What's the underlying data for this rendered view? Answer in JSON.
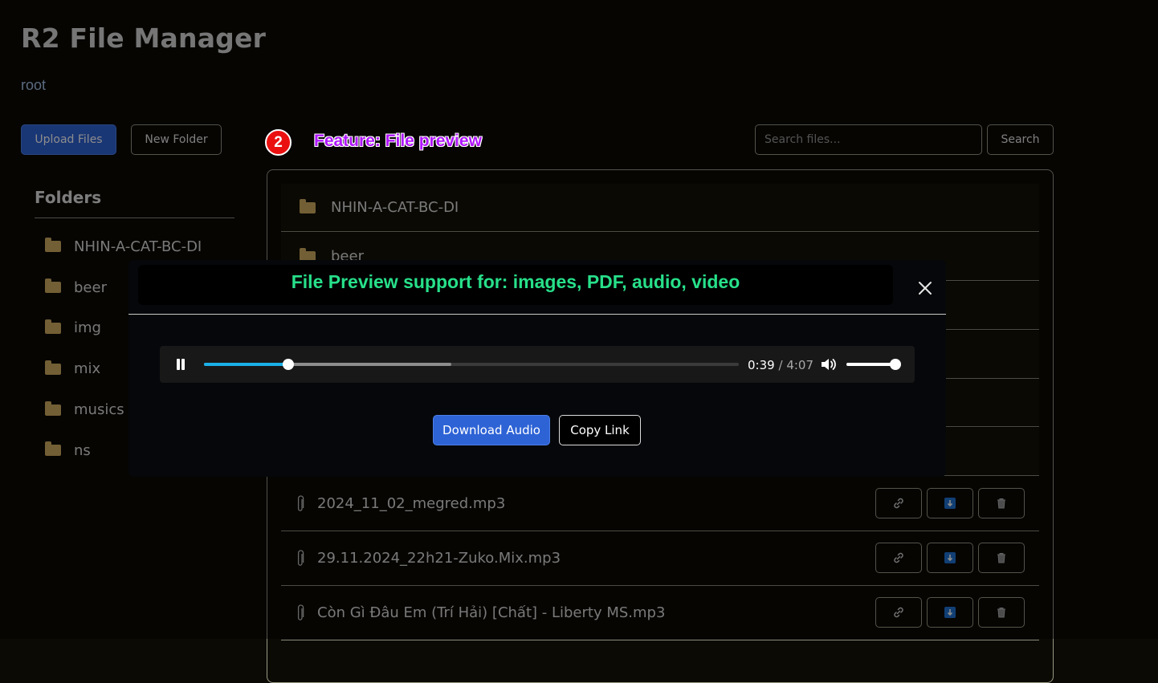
{
  "app": {
    "title": "R2 File Manager",
    "breadcrumb": "root"
  },
  "toolbar": {
    "upload_label": "Upload Files",
    "new_folder_label": "New Folder"
  },
  "search": {
    "placeholder": "Search files...",
    "button_label": "Search"
  },
  "sidebar": {
    "heading": "Folders",
    "items": [
      {
        "label": "NHIN-A-CAT-BC-DI",
        "icon": "folder-icon"
      },
      {
        "label": "beer",
        "icon": "folder-icon"
      },
      {
        "label": "img",
        "icon": "folder-icon"
      },
      {
        "label": "mix",
        "icon": "folder-icon"
      },
      {
        "label": "musics",
        "icon": "folder-icon"
      },
      {
        "label": "ns",
        "icon": "folder-icon"
      }
    ]
  },
  "file_list": {
    "folders": [
      {
        "name": "NHIN-A-CAT-BC-DI"
      },
      {
        "name": "beer"
      }
    ],
    "files": [
      {
        "name": "2024_11_02_megred.mp3",
        "icon": "paperclip-icon"
      },
      {
        "name": "29.11.2024_22h21-Zuko.Mix.mp3",
        "icon": "paperclip-icon"
      },
      {
        "name": "Còn Gì Đâu Em (Trí Hải) [Chất] - Liberty MS.mp3",
        "icon": "paperclip-icon"
      }
    ],
    "action_icons": [
      "link-icon",
      "download-icon",
      "trash-icon"
    ]
  },
  "annotation": {
    "number": "2",
    "label": "Feature: File preview",
    "number_color": "#ea1010",
    "label_color": "#b016ff"
  },
  "modal": {
    "title": "File Preview support for: images, PDF, audio, video",
    "title_color": "#27e08a",
    "player": {
      "current_time": "0:39",
      "duration": "4:07",
      "progress": 0.158,
      "buffered": 0.462,
      "volume": 1.0,
      "progress_color": "#1ab0e8"
    },
    "download_label": "Download Audio",
    "copy_link_label": "Copy Link"
  },
  "colors": {
    "background": "#0b0a04",
    "primary": "#2e63d6",
    "folder": "#d2ae62"
  }
}
